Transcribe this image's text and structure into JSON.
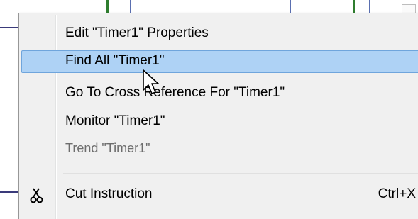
{
  "menu": {
    "items": [
      {
        "label": "Edit \"Timer1\" Properties",
        "state": "normal"
      },
      {
        "label": "Find All \"Timer1\"",
        "state": "highlighted"
      },
      {
        "label": "Go To Cross Reference For \"Timer1\"",
        "state": "normal"
      },
      {
        "label": "Monitor \"Timer1\"",
        "state": "normal"
      },
      {
        "label": "Trend \"Timer1\"",
        "state": "disabled"
      },
      {
        "label": "Cut Instruction",
        "shortcut": "Ctrl+X",
        "icon": "scissors-icon",
        "state": "normal"
      }
    ]
  },
  "colors": {
    "menu_background": "#f0f0f0",
    "highlight_fill": "#aed2f5",
    "highlight_border": "#6fa5dc",
    "disabled_text": "#6d6d6d"
  }
}
